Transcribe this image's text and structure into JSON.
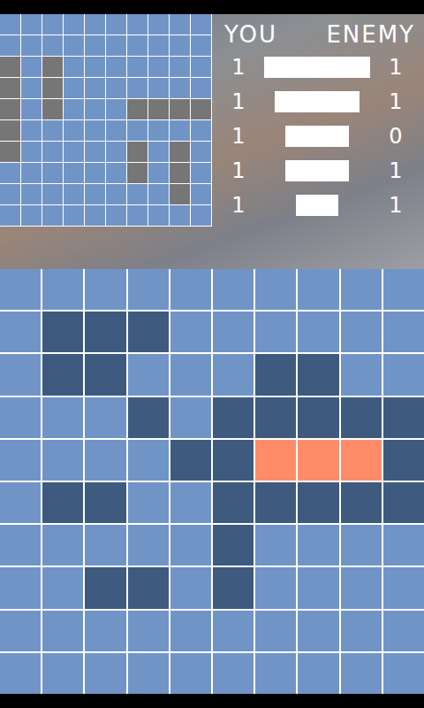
{
  "scoreboard": {
    "headers": [
      "YOU",
      "ENEMY"
    ],
    "ships": [
      {
        "you": "1",
        "enemy": "1",
        "level": 1.0
      },
      {
        "you": "1",
        "enemy": "1",
        "level": 0.8
      },
      {
        "you": "1",
        "enemy": "0",
        "level": 0.6
      },
      {
        "you": "1",
        "enemy": "1",
        "level": 0.6
      },
      {
        "you": "1",
        "enemy": "1",
        "level": 0.4
      }
    ]
  },
  "fleet_grid": {
    "rows": [
      [
        "water",
        "water",
        "water",
        "water",
        "water",
        "water",
        "water",
        "water",
        "water",
        "water"
      ],
      [
        "water",
        "water",
        "water",
        "water",
        "water",
        "water",
        "water",
        "water",
        "water",
        "water"
      ],
      [
        "ship",
        "water",
        "ship",
        "water",
        "water",
        "water",
        "water",
        "water",
        "water",
        "water"
      ],
      [
        "ship",
        "water",
        "ship",
        "water",
        "water",
        "water",
        "water",
        "water",
        "water",
        "water"
      ],
      [
        "ship",
        "water",
        "ship",
        "water",
        "water",
        "water",
        "ship",
        "ship",
        "ship",
        "ship"
      ],
      [
        "ship",
        "water",
        "water",
        "water",
        "water",
        "water",
        "water",
        "water",
        "water",
        "water"
      ],
      [
        "ship",
        "water",
        "water",
        "water",
        "water",
        "water",
        "ship",
        "water",
        "ship",
        "water"
      ],
      [
        "water",
        "water",
        "water",
        "water",
        "water",
        "water",
        "ship",
        "water",
        "ship",
        "water"
      ],
      [
        "water",
        "water",
        "water",
        "water",
        "water",
        "water",
        "water",
        "water",
        "ship",
        "water"
      ],
      [
        "water",
        "water",
        "water",
        "water",
        "water",
        "water",
        "water",
        "water",
        "water",
        "water"
      ]
    ]
  },
  "target_grid": {
    "rows": [
      [
        "water",
        "water",
        "water",
        "water",
        "water",
        "water",
        "water",
        "water",
        "water",
        "water"
      ],
      [
        "water",
        "miss",
        "miss",
        "miss",
        "water",
        "water",
        "water",
        "water",
        "water",
        "water"
      ],
      [
        "water",
        "miss",
        "miss",
        "water",
        "water",
        "water",
        "miss",
        "miss",
        "water",
        "water"
      ],
      [
        "water",
        "water",
        "water",
        "miss",
        "water",
        "miss",
        "miss",
        "miss",
        "miss",
        "miss"
      ],
      [
        "water",
        "water",
        "water",
        "water",
        "miss",
        "miss",
        "hit",
        "hit",
        "hit",
        "miss"
      ],
      [
        "water",
        "miss",
        "miss",
        "water",
        "water",
        "miss",
        "miss",
        "miss",
        "miss",
        "miss"
      ],
      [
        "water",
        "water",
        "water",
        "water",
        "water",
        "miss",
        "water",
        "water",
        "water",
        "water"
      ],
      [
        "water",
        "water",
        "miss",
        "miss",
        "water",
        "miss",
        "water",
        "water",
        "water",
        "water"
      ],
      [
        "water",
        "water",
        "water",
        "water",
        "water",
        "water",
        "water",
        "water",
        "water",
        "water"
      ],
      [
        "water",
        "water",
        "water",
        "water",
        "water",
        "water",
        "water",
        "water",
        "water",
        "water"
      ]
    ]
  }
}
